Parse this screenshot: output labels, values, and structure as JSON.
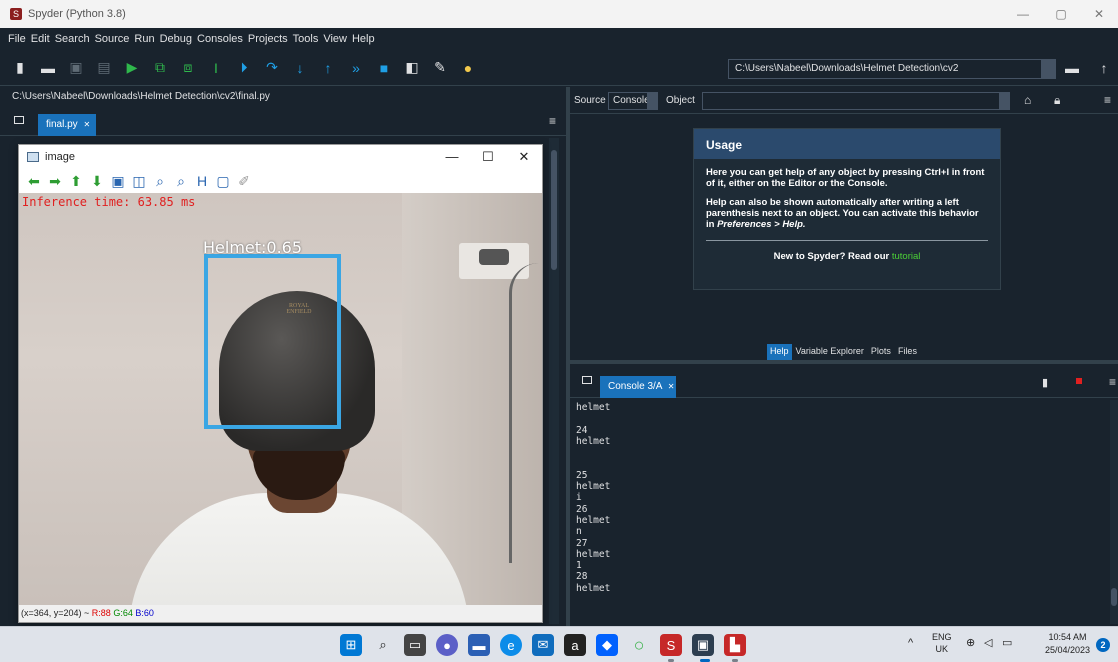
{
  "window": {
    "title": "Spyder (Python 3.8)",
    "min": "—",
    "max": "▢",
    "close": "✕"
  },
  "menu": [
    "File",
    "Edit",
    "Search",
    "Source",
    "Run",
    "Debug",
    "Consoles",
    "Projects",
    "Tools",
    "View",
    "Help"
  ],
  "toolbar": {
    "working_dir": "C:\\Users\\Nabeel\\Downloads\\Helmet Detection\\cv2"
  },
  "editor": {
    "file_path": "C:\\Users\\Nabeel\\Downloads\\Helmet Detection\\cv2\\final.py",
    "tab_label": "final.py",
    "tab_close": "✕",
    "menu_glyph": "≡"
  },
  "cv_window": {
    "title": "image",
    "inference_text": "Inference time: 63.85 ms",
    "detection_label": "Helmet:0.65",
    "helmet_brand": "ROYAL ENFIELD",
    "status_coords": "(x=364, y=204) ~ ",
    "status_r": "R:88",
    "status_g": "G:64",
    "status_b": "B:60",
    "btn_min": "—",
    "btn_max": "☐",
    "btn_close": "✕"
  },
  "help": {
    "source_label": "Source",
    "source_value": "Console",
    "object_label": "Object",
    "card_title": "Usage",
    "para1": "Here you can get help of any object by pressing Ctrl+I in front of it, either on the Editor or the Console.",
    "para2a": "Help can also be shown automatically after writing a left parenthesis next to an object. You can activate this behavior in ",
    "para2b": "Preferences > Help.",
    "footer_text": "New to Spyder? Read our ",
    "footer_link": "tutorial",
    "tabs": [
      "Help",
      "Variable Explorer",
      "Plots",
      "Files"
    ]
  },
  "console": {
    "tab_label": "Console 3/A",
    "tab_close": "✕",
    "lines": [
      "helmet",
      "",
      "24",
      "helmet",
      "",
      "",
      "25",
      "helmet",
      "i",
      "26",
      "helmet",
      "n",
      "27",
      "helmet",
      "1",
      "28",
      "helmet"
    ]
  },
  "taskbar": {
    "lang_top": "ENG",
    "lang_bottom": "UK",
    "time": "10:54 AM",
    "date": "25/04/2023",
    "notifications": "2"
  },
  "colors": {
    "accent": "#1a72bb",
    "bbox": "#3aa6e4",
    "inference": "#e02020",
    "bg": "#19232d"
  }
}
